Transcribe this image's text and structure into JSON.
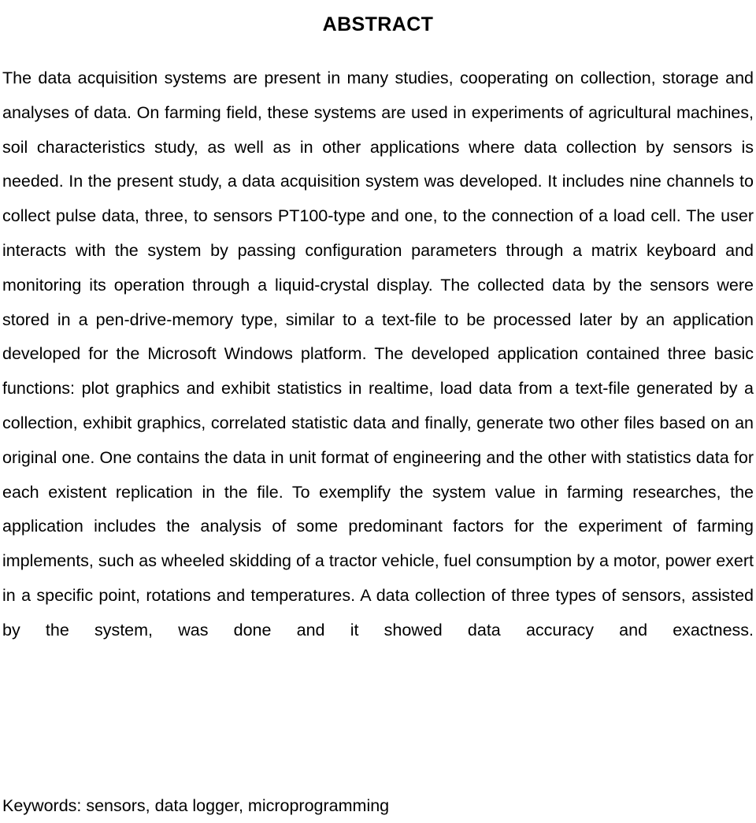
{
  "document": {
    "section_heading": "ABSTRACT",
    "abstract_text": "The data acquisition systems are present in many studies, cooperating on collection, storage and analyses of data. On farming field, these systems are used in experiments of agricultural machines, soil characteristics study, as well as in other applications where data collection by sensors is needed. In the present study, a data acquisition system was developed. It includes nine channels to collect pulse data, three, to sensors PT100-type and one, to the connection of a load cell. The user interacts with the system by passing configuration parameters through a matrix keyboard and monitoring its operation through a liquid-crystal display. The collected data by the sensors were stored in a pen-drive-memory type, similar to a text-file to be processed later by an application developed for the Microsoft Windows platform. The developed application contained three basic functions: plot graphics and exhibit statistics in realtime, load data from a text-file generated by a collection, exhibit graphics, correlated statistic data and finally, generate two other files based on an original one. One contains the data in unit format of engineering and the other with statistics data for each existent replication in the file. To exemplify the system value in farming researches, the application includes the analysis of some predominant factors for the experiment of farming implements, such as wheeled skidding of a tractor vehicle, fuel consumption by a motor, power exert in a specific point, rotations and temperatures. A data collection of three types of sensors, assisted by the system, was done and it showed data accuracy and exactness.",
    "keywords_line": "Keywords: sensors, data logger, microprogramming",
    "keywords_label": "Keywords:",
    "keywords": [
      "sensors",
      "data logger",
      "microprogramming"
    ],
    "text_color": "#000000",
    "background_color": "#ffffff"
  }
}
